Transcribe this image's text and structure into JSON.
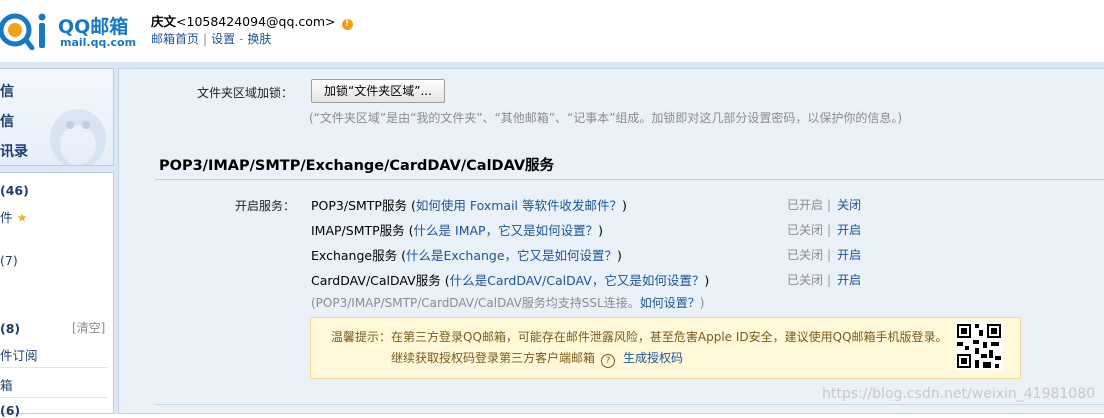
{
  "brand": {
    "name": "QQ邮箱",
    "url": "mail.qq.com"
  },
  "user": {
    "name": "庆文",
    "email": "<1058424094@qq.com>",
    "links": [
      "邮箱首页",
      "设置",
      "换肤"
    ]
  },
  "sidebar": {
    "top_items": [
      "写信",
      "收信",
      "通讯录"
    ],
    "folders": [
      {
        "label": "(46)"
      },
      {
        "label": "件"
      },
      {
        "label": "(7)"
      },
      {
        "label": "(8)"
      },
      {
        "label": "件订阅"
      },
      {
        "label": "箱"
      },
      {
        "label": "(6)"
      }
    ],
    "clean_label": "[清空]"
  },
  "main": {
    "lock_label": "文件夹区域加锁：",
    "lock_button": "加锁“文件夹区域”...",
    "lock_note": "(“文件夹区域”是由“我的文件夹”、“其他邮箱”、“记事本”组成。加锁即对这几部分设置密码，以保护你的信息。)",
    "section_title": "POP3/IMAP/SMTP/Exchange/CardDAV/CalDAV服务",
    "services_label": "开启服务：",
    "services": [
      {
        "name": "POP3/SMTP服务",
        "help": "如何使用 Foxmail 等软件收发邮件？",
        "status": "已开启",
        "action": "关闭"
      },
      {
        "name": "IMAP/SMTP服务",
        "help": "什么是 IMAP，它又是如何设置？",
        "status": "已关闭",
        "action": "开启"
      },
      {
        "name": "Exchange服务",
        "help": "什么是Exchange，它又是如何设置？",
        "status": "已关闭",
        "action": "开启"
      },
      {
        "name": "CardDAV/CalDAV服务",
        "help": "什么是CardDAV/CalDAV，它又是如何设置？",
        "status": "已关闭",
        "action": "开启"
      }
    ],
    "ssl_note": "(POP3/IMAP/SMTP/CardDAV/CalDAV服务均支持SSL连接。",
    "ssl_link": "如何设置？",
    "ssl_close": ")",
    "warning": {
      "line1": "温馨提示：在第三方登录QQ邮箱，可能存在邮件泄露风险，甚至危害Apple ID安全，建议使用QQ邮箱手机版登录。",
      "line2": "继续获取授权码登录第三方客户端邮箱",
      "help_glyph": "?",
      "link": "生成授权码"
    }
  },
  "watermark": "https://blog.csdn.net/weixin_41981080",
  "colors": {
    "accent": "#1e5494",
    "brand": "#1a78c2",
    "muted": "#8c8c8c",
    "panel": "#eaf1f9",
    "warning_bg": "#fff8d9"
  }
}
